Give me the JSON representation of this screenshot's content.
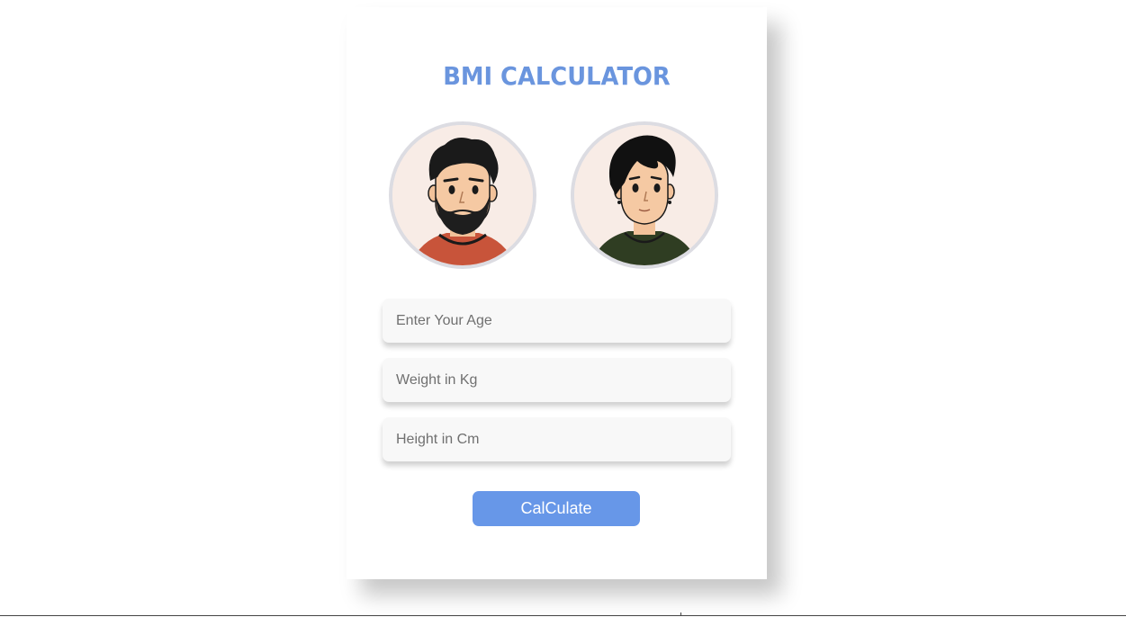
{
  "card": {
    "title": "BMI CALCULATOR"
  },
  "avatars": [
    {
      "name": "male-avatar",
      "icon": "bearded-man-avatar"
    },
    {
      "name": "female-avatar",
      "icon": "short-hair-person-avatar"
    }
  ],
  "form": {
    "age_placeholder": "Enter Your Age",
    "weight_placeholder": "Weight in Kg",
    "height_placeholder": "Height in Cm",
    "age_value": "",
    "weight_value": "",
    "height_value": ""
  },
  "actions": {
    "calculate_label": "CalCulate"
  },
  "colors": {
    "accent": "#6797e8",
    "title": "#6a95de",
    "avatar_border": "#dcdce2",
    "avatar_bg": "#f8ece6"
  }
}
